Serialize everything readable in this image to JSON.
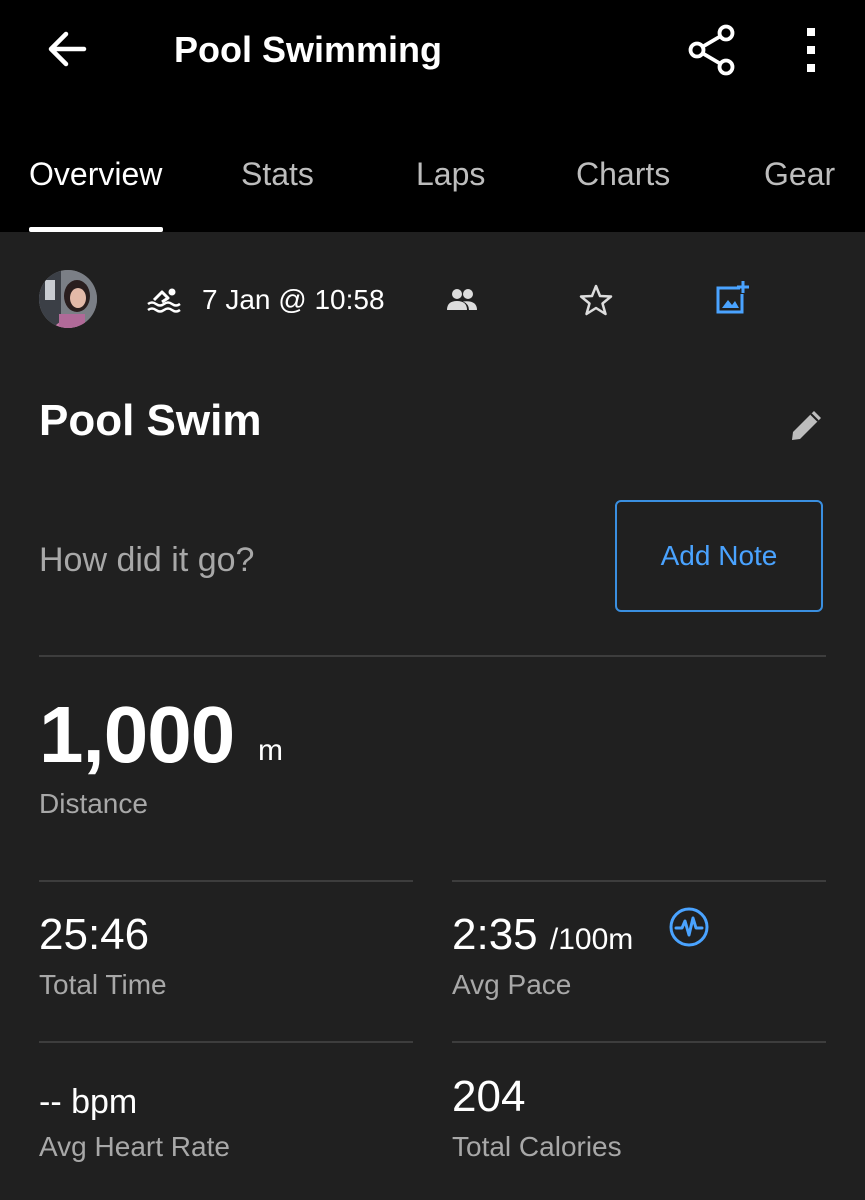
{
  "appbar": {
    "title": "Pool Swimming",
    "icons": {
      "back": "arrow-left-icon",
      "share": "share-icon",
      "more": "more-vertical-icon"
    }
  },
  "tabs": [
    {
      "label": "Overview",
      "active": true
    },
    {
      "label": "Stats",
      "active": false
    },
    {
      "label": "Laps",
      "active": false
    },
    {
      "label": "Charts",
      "active": false
    },
    {
      "label": "Gear",
      "active": false
    }
  ],
  "meta": {
    "date": "7 Jan @ 10:58",
    "icons": [
      "avatar",
      "swim-icon",
      "people-icon",
      "star-icon",
      "add-photo-icon"
    ]
  },
  "activity": {
    "name": "Pool Swim",
    "note_prompt": "How did it go?",
    "add_note_label": "Add Note"
  },
  "distance": {
    "value": "1,000",
    "unit": "m",
    "label": "Distance"
  },
  "stats": [
    {
      "value": "25:46",
      "unit": "",
      "label": "Total Time"
    },
    {
      "value": "2:35",
      "unit": "/100m",
      "label": "Avg Pace"
    },
    {
      "value": "--",
      "unit": "bpm",
      "label": "Avg Heart Rate"
    },
    {
      "value": "204",
      "unit": "",
      "label": "Total Calories"
    }
  ],
  "colors": {
    "accent": "#4aa3ff",
    "background": "#202020",
    "appbar": "#000000"
  }
}
